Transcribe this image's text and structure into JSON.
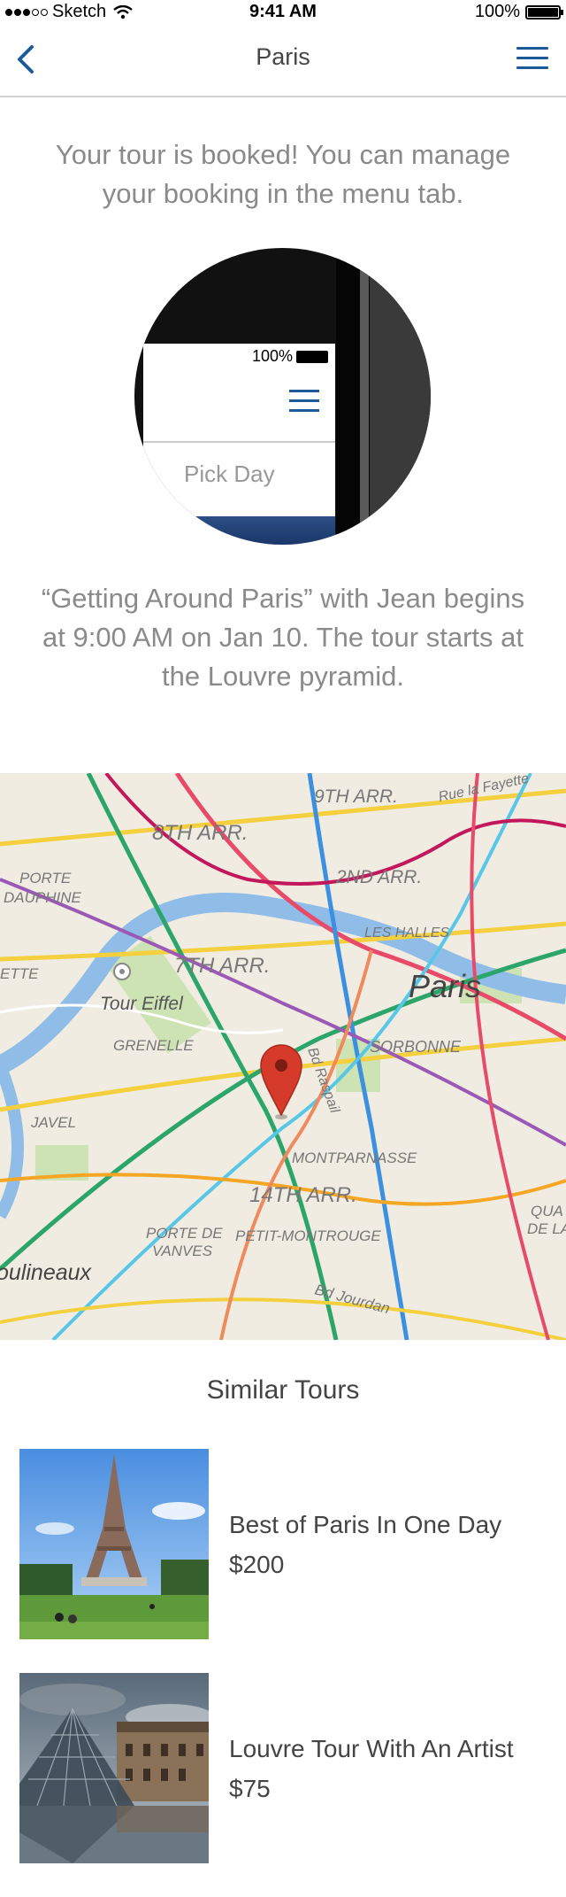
{
  "status_bar": {
    "carrier": "Sketch",
    "time": "9:41 AM",
    "battery": "100%"
  },
  "nav": {
    "title": "Paris"
  },
  "confirmation": {
    "message": "Your tour is booked! You can manage your booking in the menu tab."
  },
  "illustration": {
    "battery": "100%",
    "pick_day": "Pick Day"
  },
  "tour_details": {
    "text": "“Getting Around Paris” with Jean begins at 9:00 AM on Jan 10. The tour starts at the Louvre pyramid."
  },
  "map": {
    "labels": {
      "arr9": "9TH ARR.",
      "rue": "Rue la Fayette",
      "arr8": "8TH ARR.",
      "porte_dauphine_1": "PORTE",
      "porte_dauphine_2": "DAUPHINE",
      "arr2": "2ND ARR.",
      "les_halles": "LES HALLES",
      "arr7": "7TH ARR.",
      "ette": "ETTE",
      "paris": "Paris",
      "tour_eiffel": "Tour Eiffel",
      "grenelle": "GRENELLE",
      "sorbonne": "SORBONNE",
      "raspail": "Bd Raspail",
      "javel": "JAVEL",
      "montparnasse": "MONTPARNASSE",
      "arr14": "14TH ARR.",
      "porte_vanves_1": "PORTE DE",
      "porte_vanves_2": "VANVES",
      "petit_montrouge": "PETIT-MONTROUGE",
      "qua": "QUA",
      "dela": "DE LA",
      "moulineaux": "oulineaux",
      "jourdan": "Bd Jourdan"
    },
    "colors": {
      "background": "#f0ece2",
      "water": "#8fbde8",
      "pin": "#d63a2a"
    }
  },
  "similar": {
    "title": "Similar Tours",
    "tours": [
      {
        "name": "Best of Paris In One Day",
        "price": "$200",
        "image": "eiffel-tower-photo"
      },
      {
        "name": "Louvre Tour With An Artist",
        "price": "$75",
        "image": "louvre-pyramid-photo"
      }
    ]
  }
}
